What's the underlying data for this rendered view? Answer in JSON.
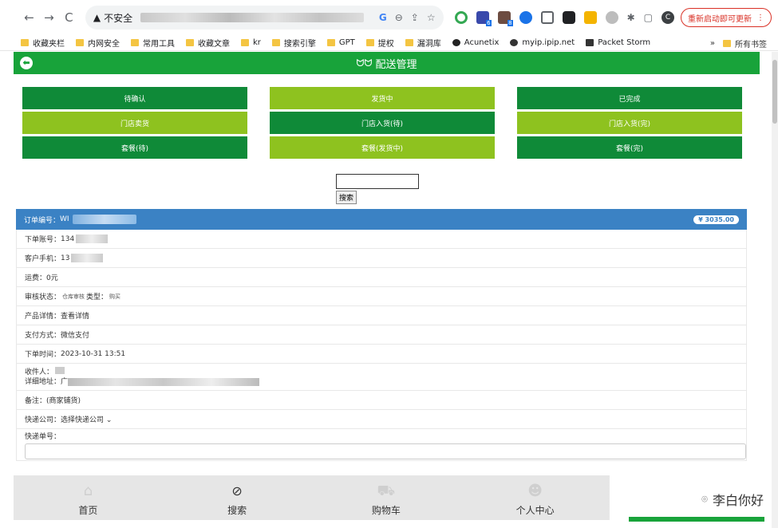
{
  "browser": {
    "nav": {
      "back": "←",
      "forward": "→",
      "reload": "C"
    },
    "security_icon": "▲",
    "security_label": "不安全",
    "update_label": "重新启动即可更新",
    "profile_initial": "C",
    "bookmarks": [
      "收藏夹栏",
      "内网安全",
      "常用工具",
      "收藏文章",
      "kr",
      "搜索引擎",
      "GPT",
      "提权",
      "漏洞库",
      "Acunetix",
      "myip.ipip.net",
      "Packet Storm"
    ],
    "bookmarks_more": "»",
    "all_bookmarks": "所有书签",
    "ext_badge_1": "6",
    "ext_badge_2": "8"
  },
  "header": {
    "title": "配送管理",
    "back_icon": "⬅",
    "logo_glyph": "ᗢᗢ"
  },
  "status_buttons": [
    {
      "label": "待确认",
      "style": "dark"
    },
    {
      "label": "发货中",
      "style": "light"
    },
    {
      "label": "已完成",
      "style": "dark"
    },
    {
      "label": "门店卖货",
      "style": "light"
    },
    {
      "label": "门店入货(待)",
      "style": "dark"
    },
    {
      "label": "门店入货(完)",
      "style": "light"
    },
    {
      "label": "套餐(待)",
      "style": "dark"
    },
    {
      "label": "套餐(发货中)",
      "style": "light"
    },
    {
      "label": "套餐(完)",
      "style": "dark"
    }
  ],
  "search": {
    "button_label": "搜索",
    "value": ""
  },
  "order": {
    "number_label": "订单编号：",
    "number_value": "WI",
    "price": "¥ 3035.00",
    "account_label": "下单账号：",
    "account_value": "134",
    "phone_label": "客户手机：",
    "phone_value": "13",
    "shipping_label": "运费：",
    "shipping_value": "0元",
    "review_label": "审核状态：",
    "review_value": "仓库审核",
    "type_label": "类型：",
    "type_value": "购买",
    "product_label": "产品详情：",
    "product_value": "查看详情",
    "payment_label": "支付方式：",
    "payment_value": "微信支付",
    "time_label": "下单时间：",
    "time_value": "2023-10-31 13:51",
    "recipient_label": "收件人：",
    "address_label": "详细地址：",
    "address_value": "广",
    "remark_label": "备注：",
    "remark_value": "(商家铺货)",
    "courier_label": "快递公司：",
    "courier_value": "选择快递公司",
    "tracking_label": "快递单号："
  },
  "bottom_nav": [
    {
      "label": "首页",
      "icon": "home-icon"
    },
    {
      "label": "搜索",
      "icon": "compass-icon"
    },
    {
      "label": "购物车",
      "icon": "cart-icon"
    },
    {
      "label": "个人中心",
      "icon": "user-icon"
    }
  ],
  "watermark": "李白你好",
  "colors": {
    "green": "#18a33a",
    "dark_green": "#0f8a38",
    "light_green": "#8ec21f",
    "blue": "#3b82c4"
  }
}
